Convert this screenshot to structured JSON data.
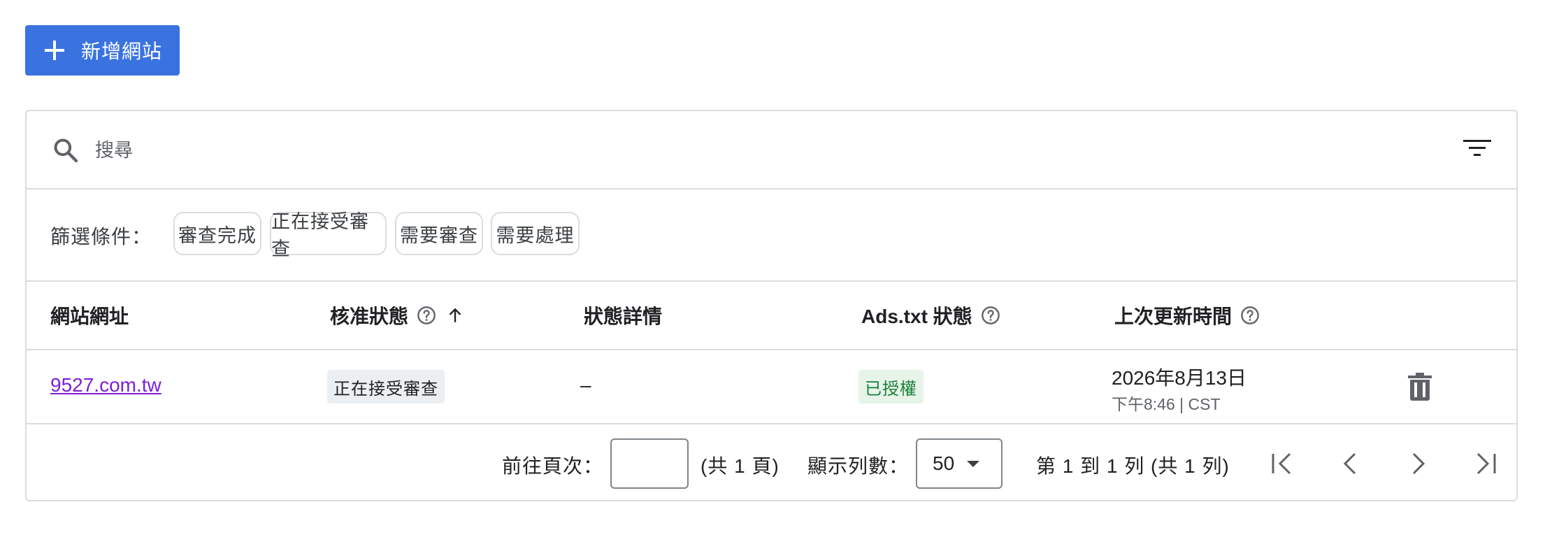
{
  "toolbar": {
    "add_site_label": "新增網站"
  },
  "search": {
    "placeholder": "搜尋"
  },
  "filters": {
    "label": "篩選條件：",
    "chips": [
      {
        "label": "審查完成"
      },
      {
        "label": "正在接受審查"
      },
      {
        "label": "需要審查"
      },
      {
        "label": "需要處理"
      }
    ]
  },
  "table": {
    "columns": {
      "site_url": "網站網址",
      "approval_status": "核准狀態",
      "status_details": "狀態詳情",
      "ads_txt_status": "Ads.txt 狀態",
      "last_updated": "上次更新時間"
    },
    "sort": {
      "column": "approval_status",
      "direction": "ascending"
    },
    "rows": [
      {
        "site_url": "9527.com.tw",
        "approval_status": "正在接受審查",
        "status_details": "–",
        "ads_txt_status": "已授權",
        "last_updated_date": "2026年8月13日",
        "last_updated_time": "下午8:46 | CST"
      }
    ]
  },
  "pagination": {
    "goto_label": "前往頁次：",
    "goto_value": "",
    "total_pages_text": "(共 1 頁)",
    "rows_label": "顯示列數：",
    "rows_value": "50",
    "range_text": "第 1 到 1 列 (共 1 列)"
  },
  "colors": {
    "primary": "#3a73e0",
    "link": "#7b1fd6",
    "authorized_bg": "#e6f4ea",
    "authorized_text": "#188038",
    "review_bg": "#eceff1",
    "border": "#dadce0"
  },
  "icons": {
    "add": "plus-icon",
    "search": "search-icon",
    "filter": "filter-list-icon",
    "help": "help-outline-icon",
    "sort": "arrow-up-icon",
    "delete": "trash-icon",
    "first": "first-page-icon",
    "prev": "chevron-left-icon",
    "next": "chevron-right-icon",
    "last": "last-page-icon"
  }
}
